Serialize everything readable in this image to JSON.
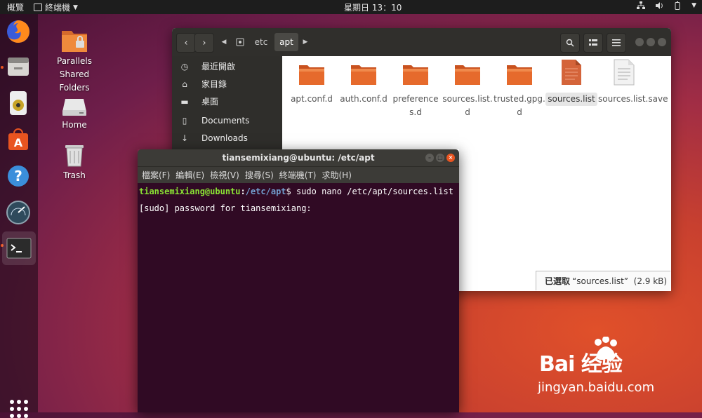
{
  "topbar": {
    "activities": "概覽",
    "app_menu": "終端機",
    "clock": "星期日 13：10",
    "tray_icons": [
      "network-icon",
      "volume-icon",
      "battery-icon",
      "power-menu-icon"
    ]
  },
  "dock": {
    "items": [
      "firefox-icon",
      "files-icon",
      "rhythmbox-icon",
      "software-center-icon",
      "help-icon",
      "time-machine-icon",
      "terminal-icon"
    ],
    "show_apps": "show-applications-icon"
  },
  "desktop": {
    "icons": [
      {
        "label": "Parallels Shared Folders",
        "icon": "shared-folder-icon"
      },
      {
        "label": "Home",
        "icon": "drive-icon"
      },
      {
        "label": "Trash",
        "icon": "trash-icon"
      }
    ]
  },
  "files_window": {
    "breadcrumbs": [
      "etc",
      "apt"
    ],
    "sidebar": [
      {
        "label": "最近開啟",
        "icon": "recent-icon"
      },
      {
        "label": "家目錄",
        "icon": "home-icon"
      },
      {
        "label": "桌面",
        "icon": "desktop-icon"
      },
      {
        "label": "Documents",
        "icon": "document-icon"
      },
      {
        "label": "Downloads",
        "icon": "download-icon"
      }
    ],
    "files": [
      {
        "label": "apt.conf.d",
        "type": "folder"
      },
      {
        "label": "auth.conf.d",
        "type": "folder"
      },
      {
        "label": "preferences.d",
        "type": "folder"
      },
      {
        "label": "sources.list.d",
        "type": "folder"
      },
      {
        "label": "trusted.gpg.d",
        "type": "folder"
      },
      {
        "label": "sources.list",
        "type": "text-selected"
      },
      {
        "label": "sources.list.save",
        "type": "text"
      }
    ],
    "status": {
      "prefix": "已選取",
      "name": "“sources.list”",
      "size": "(2.9 kB)"
    }
  },
  "terminal": {
    "title": "tiansemixiang@ubuntu: /etc/apt",
    "menu": [
      "檔案(F)",
      "編輯(E)",
      "檢視(V)",
      "搜尋(S)",
      "終端機(T)",
      "求助(H)"
    ],
    "prompt_user": "tiansemixiang@ubuntu",
    "prompt_path": "/etc/apt",
    "command": "$ sudo nano /etc/apt/sources.list",
    "output": "[sudo] password for tiansemixiang:"
  },
  "watermark": {
    "brand": "Bai 经验",
    "url": "jingyan.baidu.com"
  },
  "colors": {
    "accent": "#e95420",
    "terminal_bg": "#300a24",
    "prompt_user": "#8ae234",
    "prompt_path": "#729fcf",
    "folder": "#e66a2c"
  }
}
